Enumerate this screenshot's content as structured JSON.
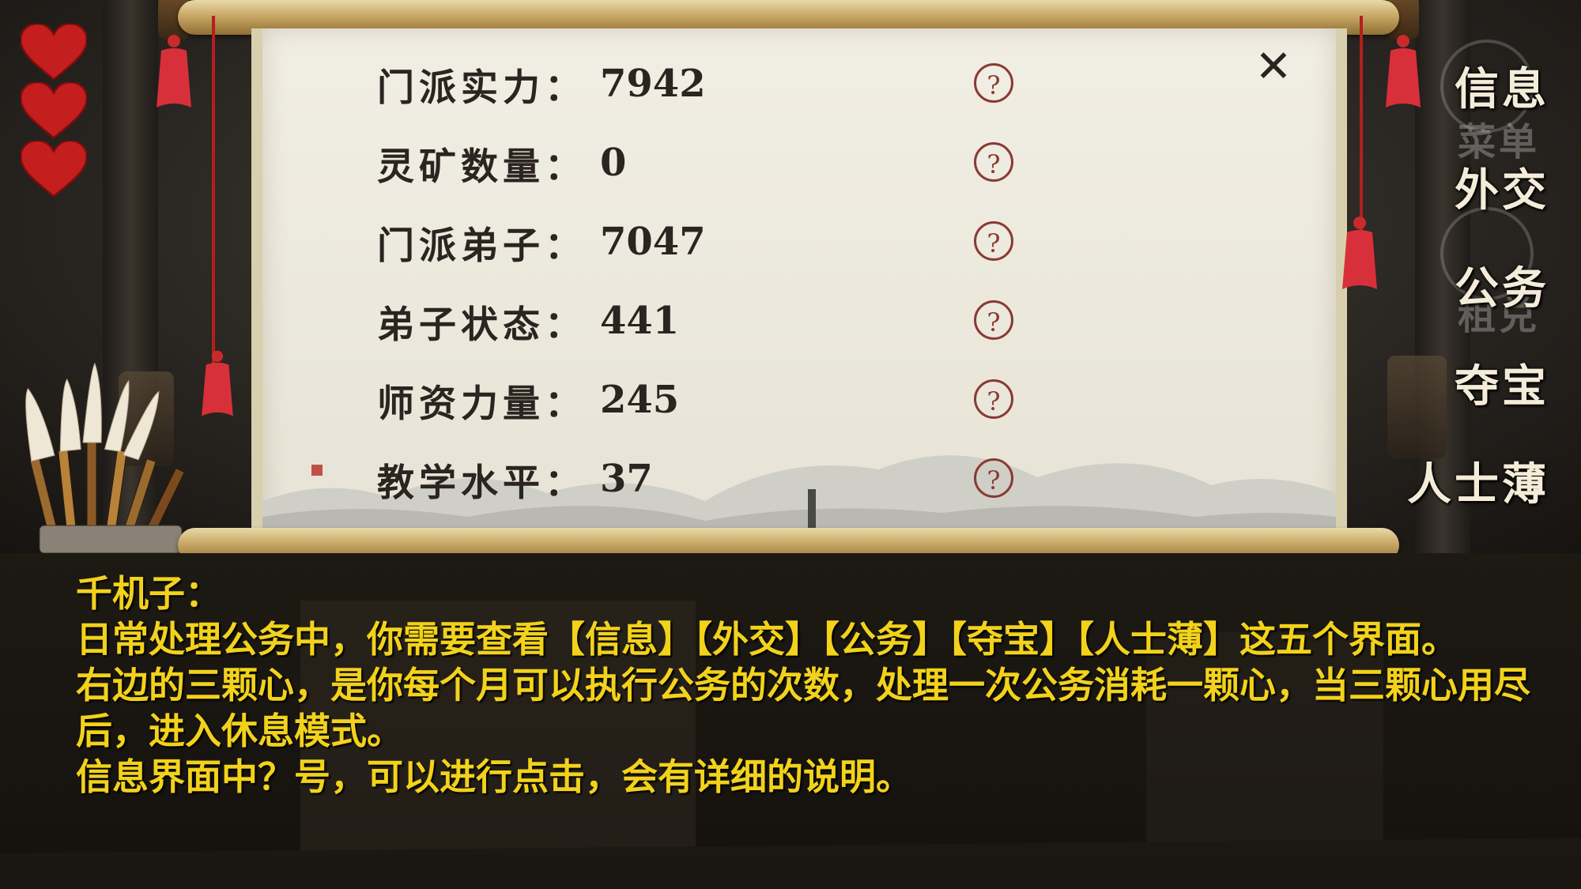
{
  "hearts": {
    "count": 3,
    "color": "#c41e1e"
  },
  "stats": [
    {
      "label": "门派实力：",
      "value": "7942"
    },
    {
      "label": "灵矿数量：",
      "value": "0"
    },
    {
      "label": "门派弟子：",
      "value": "7047"
    },
    {
      "label": "弟子状态：",
      "value": "441"
    },
    {
      "label": "师资力量：",
      "value": "245"
    },
    {
      "label": "教学水平：",
      "value": "37"
    }
  ],
  "help_glyph": "?",
  "close_glyph": "✕",
  "menu": {
    "info": "信息",
    "info_ghost": "菜单",
    "diplomacy": "外交",
    "affairs": "公务",
    "affairs_ghost": "租兑",
    "treasure": "夺宝",
    "people": "人士薄"
  },
  "dialogue": {
    "speaker": "千机子：",
    "lines": [
      "日常处理公务中，你需要查看【信息】【外交】【公务】【夺宝】【人士薄】这五个界面。",
      "右边的三颗心，是你每个月可以执行公务的次数，处理一次公务消耗一颗心，当三颗心用尽后，进入休息模式。",
      "信息界面中？号，可以进行点击，会有详细的说明。"
    ]
  },
  "colors": {
    "dialogue_text": "#f2d21b",
    "help_ring": "#8a3a32",
    "heart": "#c41e1e"
  }
}
